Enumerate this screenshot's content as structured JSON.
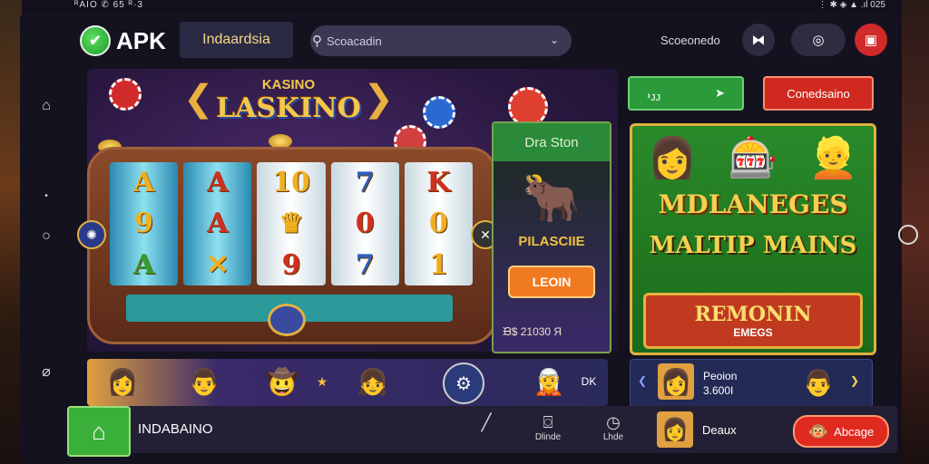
{
  "status_bar": {
    "left": "ᴿAIO ✆ 65 ᴿ·3",
    "right": "⋮ ✱ ◈ ▲ .ıl 025"
  },
  "header": {
    "logo_text": "APK",
    "category_button": "Indaardsia",
    "search_placeholder": "Scoacadin",
    "account_label": "Scoeonedo",
    "icons": [
      "bookmark-icon",
      "compass-icon",
      "gift-icon"
    ]
  },
  "slot_machine": {
    "title": "LASKINO",
    "title_top": "KASINO",
    "reels": [
      [
        "A",
        "9",
        "A"
      ],
      [
        "A",
        "A",
        "✕"
      ],
      [
        "10",
        "♛",
        "9"
      ],
      [
        "7",
        "0",
        "7"
      ],
      [
        "K",
        "0",
        "1"
      ]
    ]
  },
  "promo_card": {
    "header": "Dra Ston",
    "tag": "PILASCIIE",
    "button": "LEOIN",
    "footer": "ᙖ$ 21030 Я"
  },
  "right_panel": {
    "green_pill": "᠈ᴊᴊ",
    "red_pill": "Conedsaino",
    "feature_title": "MDLANEGES",
    "feature_subtitle": "MALTIP MAINS",
    "feature_banner": "REMONIN",
    "feature_banner_sub": "EMEGS",
    "side_entry": [
      "Peoion",
      "3.600I"
    ]
  },
  "avatar_strip": {
    "tail_label": "DK"
  },
  "bottom_bar": {
    "label": "INDABAINO",
    "tools": [
      {
        "label": "",
        "icon": "pencil-icon"
      },
      {
        "label": "Dlinde",
        "icon": "camera-icon"
      },
      {
        "label": "Lhde",
        "icon": "clock-icon"
      }
    ],
    "user": "Deaux",
    "cta": "Abcage"
  },
  "colors": {
    "accent_green": "#3ab03a",
    "accent_red": "#e02a20",
    "accent_gold": "#f3c84a",
    "panel_bg": "#232035"
  }
}
